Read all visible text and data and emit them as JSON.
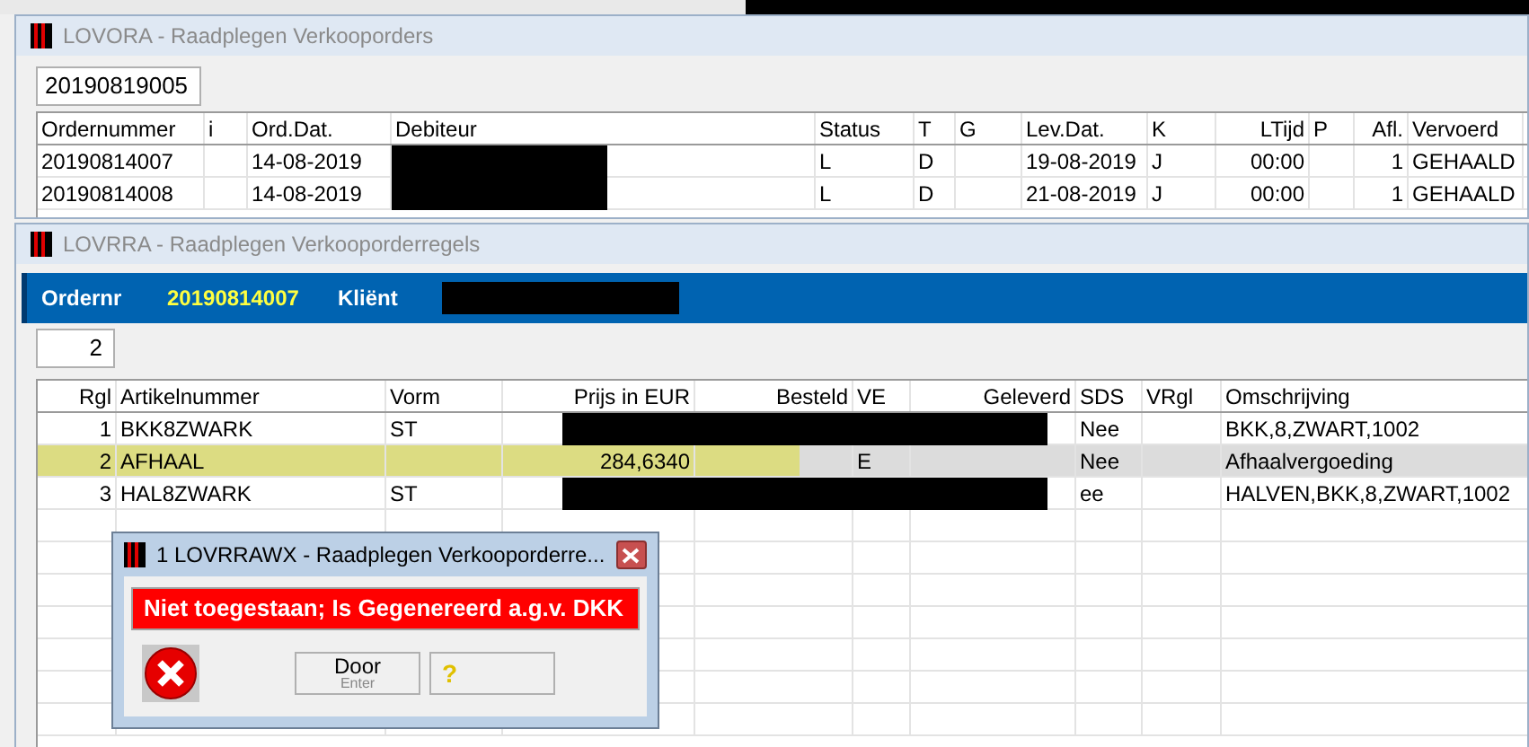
{
  "orders_window": {
    "title": "LOVORA - Raadplegen Verkooporders",
    "search_value": "20190819005",
    "columns": [
      "Ordernummer",
      "i",
      "Ord.Dat.",
      "Debiteur",
      "Status",
      "T",
      "G",
      "Lev.Dat.",
      "K",
      "LTijd",
      "P",
      "Afl.",
      "Vervoerd"
    ],
    "rows": [
      {
        "cells": [
          "20190814007",
          "",
          "14-08-2019",
          "",
          "L",
          "D",
          "",
          "19-08-2019",
          "J",
          "00:00",
          "",
          "1",
          "GEHAALD"
        ],
        "debiteur_redacted": true
      },
      {
        "cells": [
          "20190814008",
          "",
          "14-08-2019",
          "",
          "L",
          "D",
          "",
          "21-08-2019",
          "J",
          "00:00",
          "",
          "1",
          "GEHAALD"
        ],
        "debiteur_redacted": true
      }
    ]
  },
  "lines_window": {
    "title": "LOVRRA - Raadplegen Verkooporderregels",
    "header": {
      "order_label": "Ordernr",
      "order_number": "20190814007",
      "client_label": "Kliënt",
      "client_redacted": true
    },
    "line_value": "2",
    "columns": [
      "Rgl",
      "Artikelnummer",
      "Vorm",
      "Prijs in EUR",
      "Besteld",
      "VE",
      "Geleverd",
      "SDS",
      "VRgl",
      "Omschrijving"
    ],
    "rows": [
      {
        "cells": [
          "1",
          "BKK8ZWARK",
          "ST",
          "",
          "",
          "",
          "",
          "Nee",
          "",
          "BKK,8,ZWART,1002"
        ],
        "redacted": true,
        "selected": false
      },
      {
        "cells": [
          "2",
          "AFHAAL",
          "",
          "284,6340",
          "",
          "E",
          "",
          "Nee",
          "",
          "Afhaalvergoeding"
        ],
        "redacted": false,
        "selected": true
      },
      {
        "cells": [
          "3",
          "HAL8ZWARK",
          "ST",
          "",
          "",
          "",
          "",
          "ee",
          "",
          "HALVEN,BKK,8,ZWART,1002"
        ],
        "redacted": true,
        "selected": false
      }
    ]
  },
  "dialog": {
    "title": "1 LOVRRAWX - Raadplegen Verkooporderre...",
    "message": "Niet toegestaan; Is Gegenereerd a.g.v. DKK",
    "button_label": "Door",
    "button_hint": "Enter",
    "help_label": "?"
  }
}
